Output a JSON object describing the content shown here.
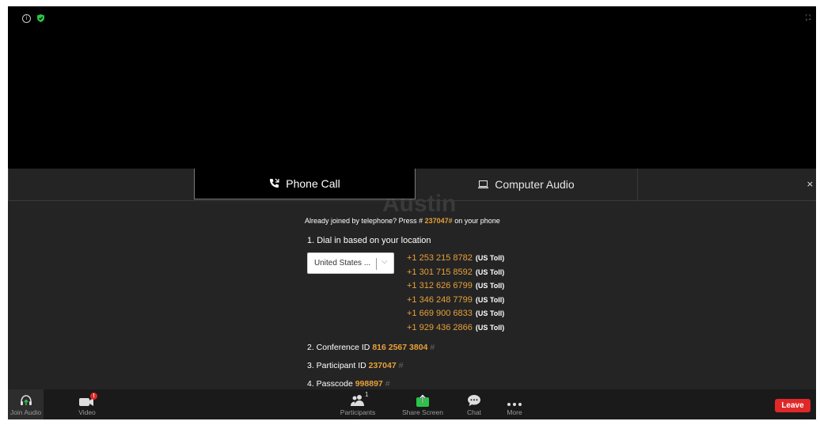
{
  "video": {
    "fullscreen_glyph": "⛶"
  },
  "tabs": {
    "phone_label": "Phone Call",
    "computer_label": "Computer Audio",
    "close_glyph": "×"
  },
  "watermark": "Austin",
  "already_joined": {
    "prefix": "Already joined by telephone? Press #",
    "code": "237047#",
    "suffix": "on your phone"
  },
  "dial": {
    "heading": "1. Dial in based on your location",
    "country_value": "United States ...",
    "numbers": [
      {
        "number": "+1 253 215 8782",
        "type": "(US Toll)"
      },
      {
        "number": "+1 301 715 8592",
        "type": "(US Toll)"
      },
      {
        "number": "+1 312 626 6799",
        "type": "(US Toll)"
      },
      {
        "number": "+1 346 248 7799",
        "type": "(US Toll)"
      },
      {
        "number": "+1 669 900 6833",
        "type": "(US Toll)"
      },
      {
        "number": "+1 929 436 2866",
        "type": "(US Toll)"
      }
    ]
  },
  "conference": {
    "label": "2. Conference ID",
    "value": "816 2567 3804",
    "hash": "#"
  },
  "participant": {
    "label": "3. Participant ID",
    "value": "237047",
    "hash": "#"
  },
  "passcode": {
    "label": "4. Passcode",
    "value": "998897",
    "hash": "#"
  },
  "toolbar": {
    "join_audio": "Join Audio",
    "video": "Video",
    "video_badge": "!",
    "participants": "Participants",
    "participants_count": "1",
    "share_screen": "Share Screen",
    "chat": "Chat",
    "more": "More",
    "leave": "Leave"
  },
  "colors": {
    "accent_orange": "#e8a03a",
    "leave_red": "#e02828",
    "share_green": "#2bc44a"
  }
}
